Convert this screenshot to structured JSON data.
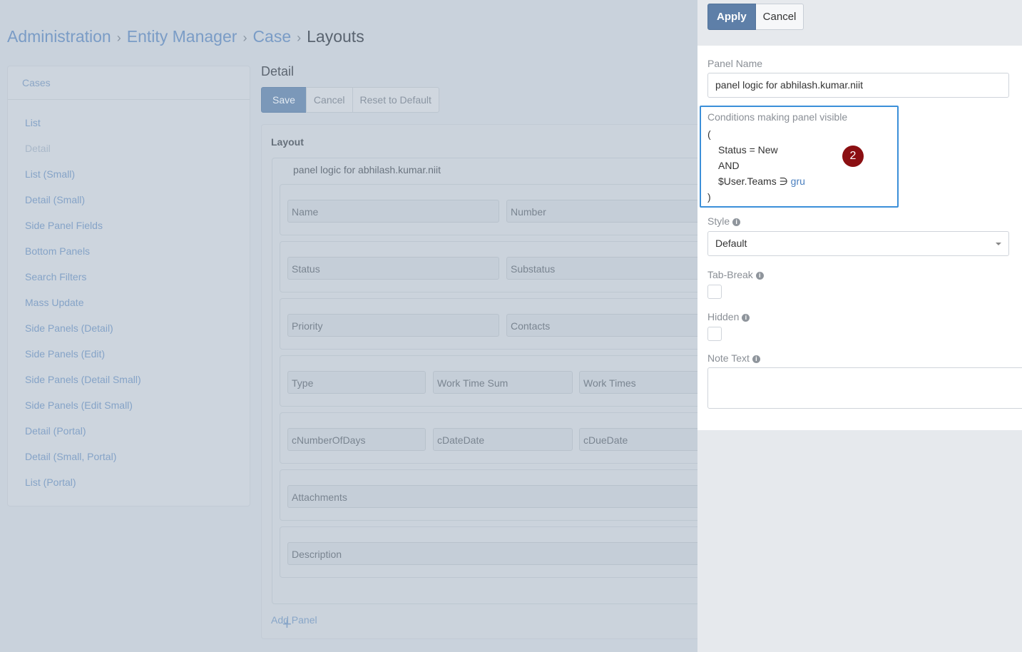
{
  "breadcrumb": {
    "items": [
      "Administration",
      "Entity Manager",
      "Case"
    ],
    "current": "Layouts",
    "separator": "›"
  },
  "left_panel": {
    "header": "Cases",
    "items": [
      "List",
      "Detail",
      "List (Small)",
      "Detail (Small)",
      "Side Panel Fields",
      "Bottom Panels",
      "Search Filters",
      "Mass Update",
      "Side Panels (Detail)",
      "Side Panels (Edit)",
      "Side Panels (Detail Small)",
      "Side Panels (Edit Small)",
      "Detail (Portal)",
      "Detail (Small, Portal)",
      "List (Portal)"
    ],
    "active": "Detail"
  },
  "detail": {
    "title": "Detail",
    "buttons": {
      "save": "Save",
      "cancel": "Cancel",
      "reset": "Reset to Default"
    },
    "layout_label": "Layout",
    "panel_name": "panel logic for abhilash.kumar.niit",
    "rows": [
      [
        "Name",
        "Number"
      ],
      [
        "Status",
        "Substatus"
      ],
      [
        "Priority",
        "Contacts"
      ],
      [
        "Type",
        "Work Time Sum",
        "Work Times"
      ],
      [
        "cNumberOfDays",
        "cDateDate",
        "cDueDate"
      ],
      [
        "Attachments"
      ],
      [
        "Description"
      ]
    ],
    "add_icon": "+",
    "add_panel": "Add Panel"
  },
  "modal": {
    "apply": "Apply",
    "cancel": "Cancel",
    "panel_name_label": "Panel Name",
    "panel_name_value": "panel logic for abhilash.kumar.niit",
    "conditions_label": "Conditions making panel visible",
    "conditions": {
      "open": "(",
      "line1": "Status = New",
      "line2": "AND",
      "line3_prefix": "$User.Teams ∋",
      "line3_link": "gru",
      "close": ")"
    },
    "style_label": "Style",
    "style_value": "Default",
    "tab_break_label": "Tab-Break",
    "hidden_label": "Hidden",
    "note_text_label": "Note Text",
    "info_icon": "i"
  },
  "step_badge": "2",
  "colors": {
    "accent": "#5e7fa8",
    "highlight": "#3b8fd9",
    "badge": "#8b0f12"
  }
}
